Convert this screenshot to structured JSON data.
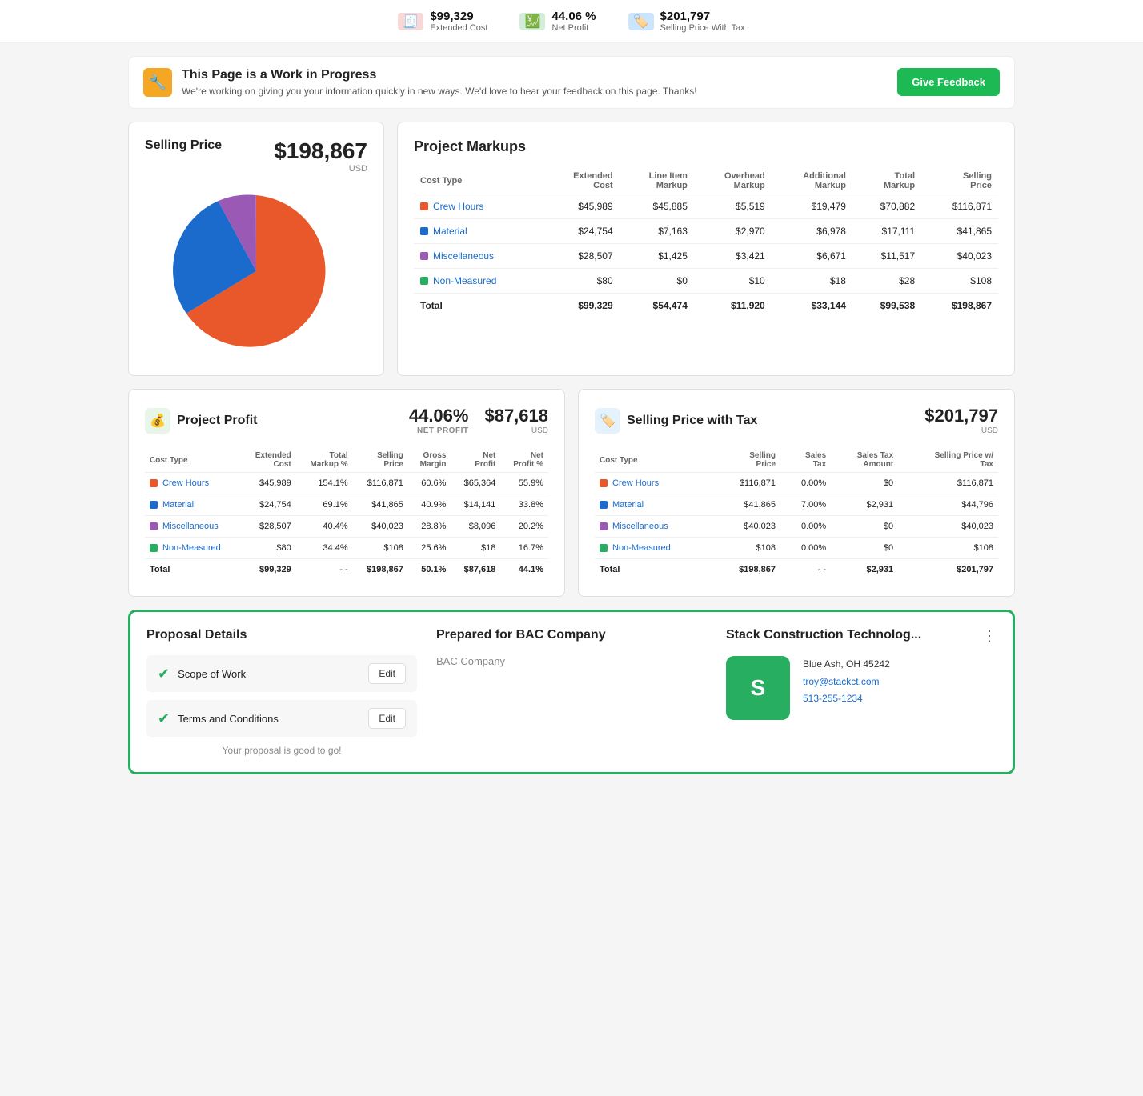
{
  "topbar": {
    "extended_cost_label": "Extended Cost",
    "extended_cost_value": "$99,329",
    "net_profit_label": "Net Profit",
    "net_profit_value": "44.06 %",
    "selling_price_label": "Selling Price With Tax",
    "selling_price_value": "$201,797"
  },
  "wip": {
    "title": "This Page is a Work in Progress",
    "subtitle": "We're working on giving you your information quickly in new ways. We'd love to hear your feedback on this page. Thanks!",
    "feedback_btn": "Give Feedback"
  },
  "selling_price": {
    "title": "Selling Price",
    "value": "$198,867",
    "currency": "USD"
  },
  "project_markups": {
    "title": "Project Markups",
    "columns": [
      "Cost Type",
      "Extended Cost",
      "Line Item Markup",
      "Overhead Markup",
      "Additional Markup",
      "Total Markup",
      "Selling Price"
    ],
    "rows": [
      {
        "type": "Crew Hours",
        "color": "orange",
        "extended_cost": "$45,989",
        "line_item": "$45,885",
        "overhead": "$5,519",
        "additional": "$19,479",
        "total": "$70,882",
        "selling": "$116,871"
      },
      {
        "type": "Material",
        "color": "blue",
        "extended_cost": "$24,754",
        "line_item": "$7,163",
        "overhead": "$2,970",
        "additional": "$6,978",
        "total": "$17,111",
        "selling": "$41,865"
      },
      {
        "type": "Miscellaneous",
        "color": "purple",
        "extended_cost": "$28,507",
        "line_item": "$1,425",
        "overhead": "$3,421",
        "additional": "$6,671",
        "total": "$11,517",
        "selling": "$40,023"
      },
      {
        "type": "Non-Measured",
        "color": "green",
        "extended_cost": "$80",
        "line_item": "$0",
        "overhead": "$10",
        "additional": "$18",
        "total": "$28",
        "selling": "$108"
      }
    ],
    "total_row": {
      "label": "Total",
      "extended_cost": "$99,329",
      "line_item": "$54,474",
      "overhead": "$11,920",
      "additional": "$33,144",
      "total": "$99,538",
      "selling": "$198,867"
    }
  },
  "project_profit": {
    "title": "Project Profit",
    "net_profit_pct": "44.06%",
    "net_profit_pct_label": "NET PROFIT",
    "gross_value": "$87,618",
    "gross_label": "USD",
    "columns": [
      "Cost Type",
      "Extended Cost",
      "Total Markup %",
      "Selling Price",
      "Gross Margin",
      "Net Profit",
      "Net Profit %"
    ],
    "rows": [
      {
        "type": "Crew Hours",
        "color": "orange",
        "extended": "$45,989",
        "markup_pct": "154.1%",
        "selling": "$116,871",
        "gross_margin": "60.6%",
        "net_profit": "$65,364",
        "net_pct": "55.9%"
      },
      {
        "type": "Material",
        "color": "blue",
        "extended": "$24,754",
        "markup_pct": "69.1%",
        "selling": "$41,865",
        "gross_margin": "40.9%",
        "net_profit": "$14,141",
        "net_pct": "33.8%"
      },
      {
        "type": "Miscellaneous",
        "color": "purple",
        "extended": "$28,507",
        "markup_pct": "40.4%",
        "selling": "$40,023",
        "gross_margin": "28.8%",
        "net_profit": "$8,096",
        "net_pct": "20.2%"
      },
      {
        "type": "Non-Measured",
        "color": "green",
        "extended": "$80",
        "markup_pct": "34.4%",
        "selling": "$108",
        "gross_margin": "25.6%",
        "net_profit": "$18",
        "net_pct": "16.7%"
      }
    ],
    "total_row": {
      "label": "Total",
      "extended": "$99,329",
      "markup_pct": "- -",
      "selling": "$198,867",
      "gross_margin": "50.1%",
      "net_profit": "$87,618",
      "net_pct": "44.1%"
    }
  },
  "selling_price_tax": {
    "title": "Selling Price with Tax",
    "value": "$201,797",
    "currency": "USD",
    "columns": [
      "Cost Type",
      "Selling Price",
      "Sales Tax",
      "Sales Tax Amount",
      "Selling Price w/ Tax"
    ],
    "rows": [
      {
        "type": "Crew Hours",
        "color": "orange",
        "selling": "$116,871",
        "tax_pct": "0.00%",
        "tax_amount": "$0",
        "final": "$116,871"
      },
      {
        "type": "Material",
        "color": "blue",
        "selling": "$41,865",
        "tax_pct": "7.00%",
        "tax_amount": "$2,931",
        "final": "$44,796"
      },
      {
        "type": "Miscellaneous",
        "color": "purple",
        "selling": "$40,023",
        "tax_pct": "0.00%",
        "tax_amount": "$0",
        "final": "$40,023"
      },
      {
        "type": "Non-Measured",
        "color": "green",
        "selling": "$108",
        "tax_pct": "0.00%",
        "tax_amount": "$0",
        "final": "$108"
      }
    ],
    "total_row": {
      "label": "Total",
      "selling": "$198,867",
      "tax_pct": "- -",
      "tax_amount": "$2,931",
      "final": "$201,797"
    }
  },
  "proposal": {
    "details_title": "Proposal Details",
    "scope_label": "Scope of Work",
    "scope_edit": "Edit",
    "terms_label": "Terms and Conditions",
    "terms_edit": "Edit",
    "good_msg": "Your proposal is good to go!",
    "prepared_title": "Prepared for BAC Company",
    "prepared_company": "BAC Company",
    "company_title": "Stack Construction Technolog...",
    "company_address": "Blue Ash, OH 45242",
    "company_email": "troy@stackct.com",
    "company_phone": "513-255-1234"
  }
}
